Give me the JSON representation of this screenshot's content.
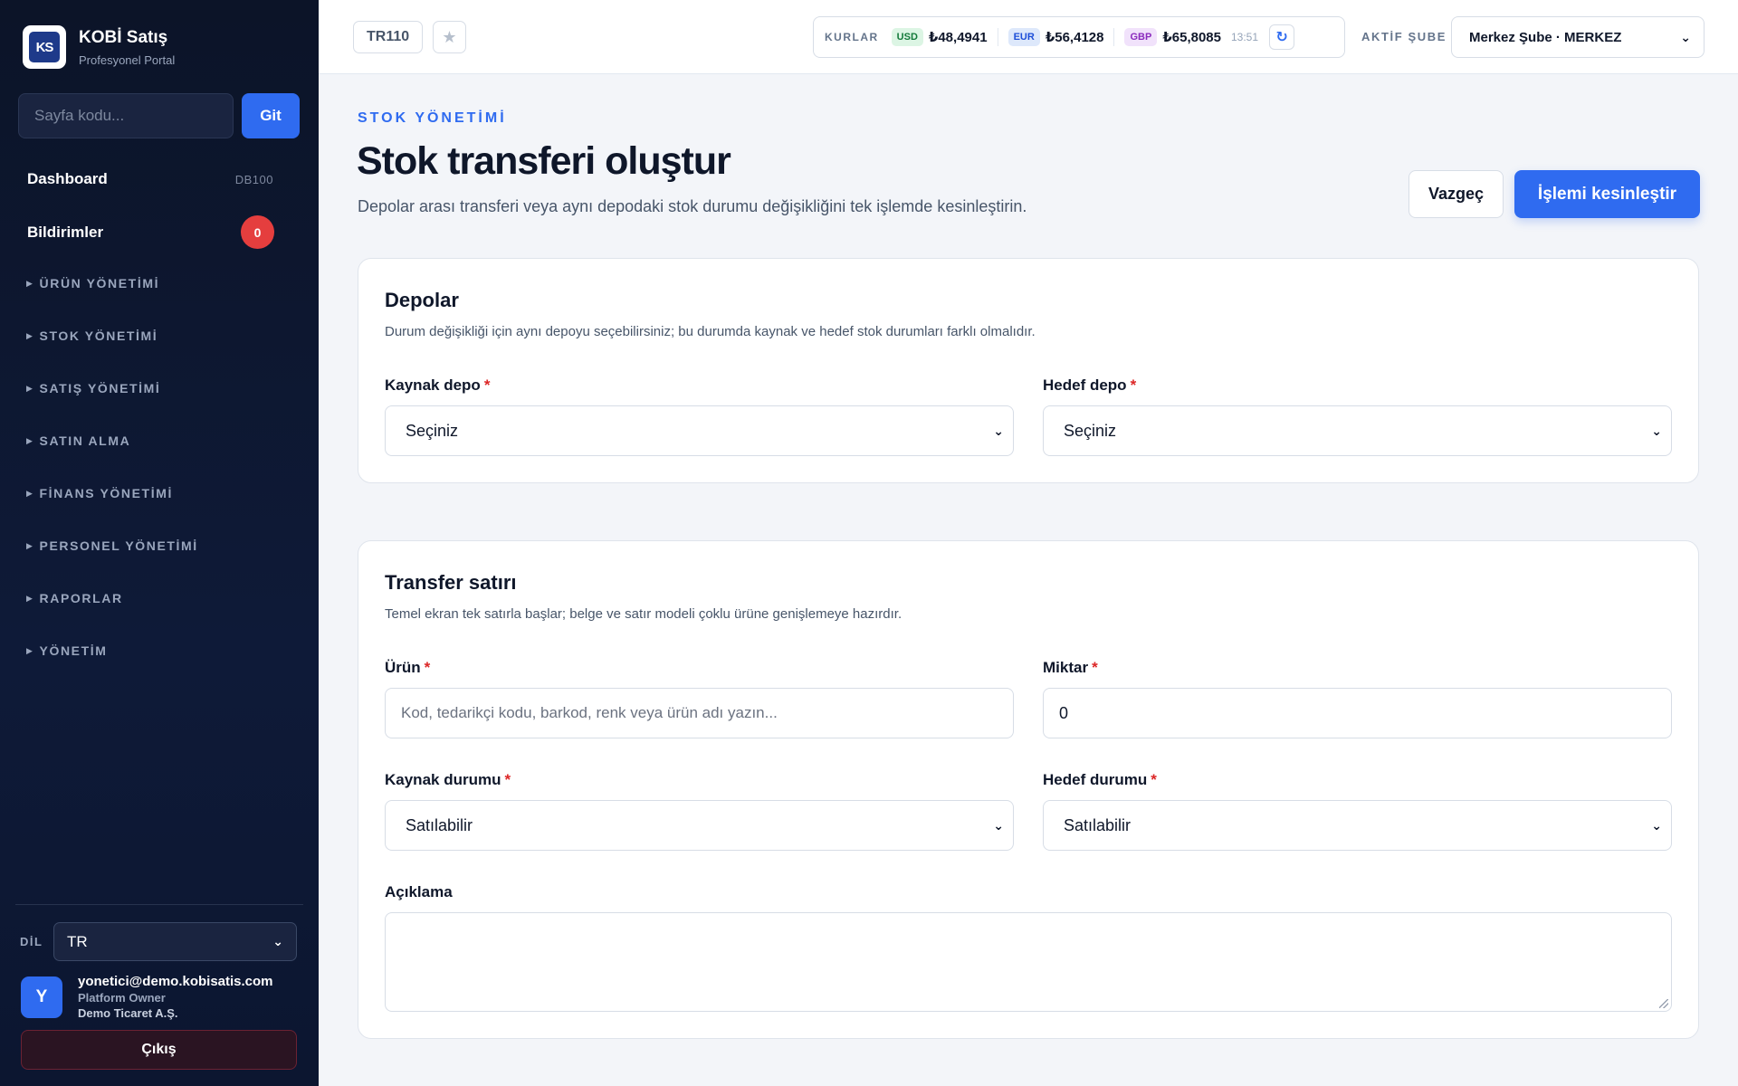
{
  "brand": {
    "logo_text": "KS",
    "name": "KOBİ Satış",
    "subtitle": "Profesyonel Portal"
  },
  "sidebar": {
    "search_placeholder": "Sayfa kodu...",
    "go_label": "Git",
    "dashboard": {
      "label": "Dashboard",
      "code": "DB100"
    },
    "notifications": {
      "label": "Bildirimler",
      "count": "0"
    },
    "groups": [
      "ÜRÜN YÖNETİMİ",
      "STOK YÖNETİMİ",
      "SATIŞ YÖNETİMİ",
      "SATIN ALMA",
      "FİNANS YÖNETİMİ",
      "PERSONEL YÖNETİMİ",
      "RAPORLAR",
      "YÖNETİM"
    ],
    "language": {
      "label": "DİL",
      "value": "TR"
    },
    "user": {
      "initial": "Y",
      "email": "yonetici@demo.kobisatis.com",
      "role": "Platform Owner",
      "company": "Demo Ticaret A.Ş."
    },
    "logout_label": "Çıkış"
  },
  "topbar": {
    "page_code": "TR110",
    "rates": {
      "label": "KURLAR",
      "usd": {
        "code": "USD",
        "value": "₺48,4941"
      },
      "eur": {
        "code": "EUR",
        "value": "₺56,4128"
      },
      "gbp": {
        "code": "GBP",
        "value": "₺65,8085"
      },
      "time": "13:51"
    },
    "branch": {
      "label": "AKTİF ŞUBE",
      "value": "Merkez Şube · MERKEZ"
    }
  },
  "page": {
    "section": "STOK YÖNETİMİ",
    "title": "Stok transferi oluştur",
    "description": "Depolar arası transferi veya aynı depodaki stok durumu değişikliğini tek işlemde kesinleştirin.",
    "cancel_label": "Vazgeç",
    "commit_label": "İşlemi kesinleştir"
  },
  "warehouses": {
    "title": "Depolar",
    "description": "Durum değişikliği için aynı depoyu seçebilirsiniz; bu durumda kaynak ve hedef stok durumları farklı olmalıdır.",
    "source_label": "Kaynak depo",
    "source_value": "Seçiniz",
    "target_label": "Hedef depo",
    "target_value": "Seçiniz"
  },
  "transfer": {
    "title": "Transfer satırı",
    "description": "Temel ekran tek satırla başlar; belge ve satır modeli çoklu ürüne genişlemeye hazırdır.",
    "product_label": "Ürün",
    "product_placeholder": "Kod, tedarikçi kodu, barkod, renk veya ürün adı yazın...",
    "quantity_label": "Miktar",
    "quantity_value": "0",
    "source_status_label": "Kaynak durumu",
    "source_status_value": "Satılabilir",
    "target_status_label": "Hedef durumu",
    "target_status_value": "Satılabilir",
    "note_label": "Açıklama"
  },
  "required_mark": "*",
  "colors": {
    "accent": "#2f6bf0",
    "sidebar_bg": "#0c1428",
    "danger": "#dc2626"
  },
  "icons": {
    "favorite": "star-icon",
    "refresh": "refresh-icon",
    "dropdown": "chevron-down-icon",
    "group": "caret-right-icon"
  }
}
